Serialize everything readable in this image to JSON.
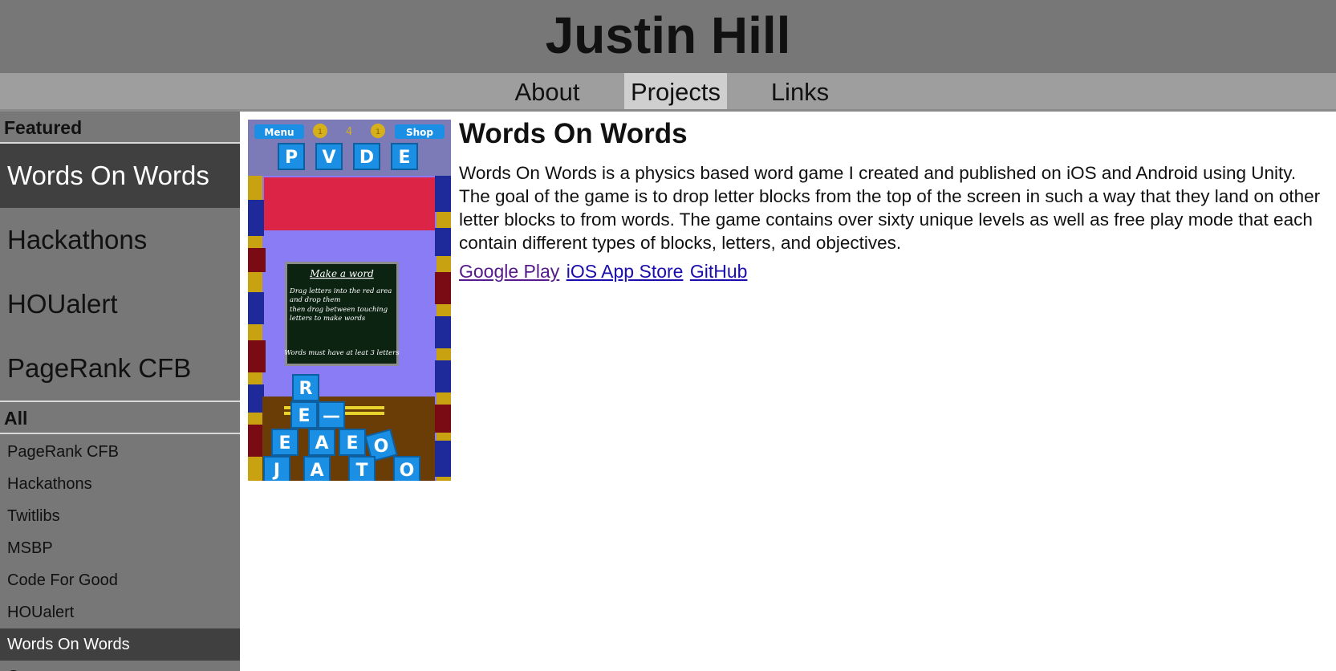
{
  "header": {
    "title": "Justin Hill"
  },
  "nav": {
    "items": [
      "About",
      "Projects",
      "Links"
    ],
    "active": "Projects"
  },
  "sidebar": {
    "featured_heading": "Featured",
    "featured": [
      "Words On Words",
      "Hackathons",
      "HOUalert",
      "PageRank CFB"
    ],
    "all_heading": "All",
    "all": [
      "PageRank CFB",
      "Hackathons",
      "Twitlibs",
      "MSBP",
      "Code For Good",
      "HOUalert",
      "Words On Words",
      "Ge..."
    ]
  },
  "project": {
    "title": "Words On Words",
    "description": "Words On Words is a physics based word game I created and published on iOS and Android using Unity. The goal of the game is to drop letter blocks from the top of the screen in such a way that they land on other letter blocks to from words. The game contains over sixty unique levels as well as free play mode that each contain different types of blocks, letters, and objectives.",
    "links": [
      "Google Play",
      "iOS App Store",
      "GitHub"
    ]
  },
  "game_screenshot": {
    "menu_label": "Menu",
    "shop_label": "Shop",
    "coin_left": "1",
    "count": "4",
    "coin_right": "1",
    "top_letters": [
      "P",
      "V",
      "D",
      "E"
    ],
    "panel_title": "Make a word",
    "panel_line1": "Drag letters into the red area",
    "panel_line2": "and drop them",
    "panel_line3": "then drag between touching",
    "panel_line4": "letters to make words",
    "panel_footer": "Words must have at leat 3 letters",
    "blocks": [
      "R",
      "E",
      "—",
      "E",
      "A",
      "E",
      "O",
      "J",
      "A",
      "T",
      "O"
    ]
  },
  "colors": {
    "header_bg": "#777777",
    "nav_bg": "#9e9e9e",
    "sidebar_bg": "#777777",
    "active_bg": "#404040",
    "block_blue": "#1a8fe3",
    "red_zone": "#dc2446",
    "purple_bg": "#8a7cf5",
    "floor_brown": "#6b3d06"
  }
}
